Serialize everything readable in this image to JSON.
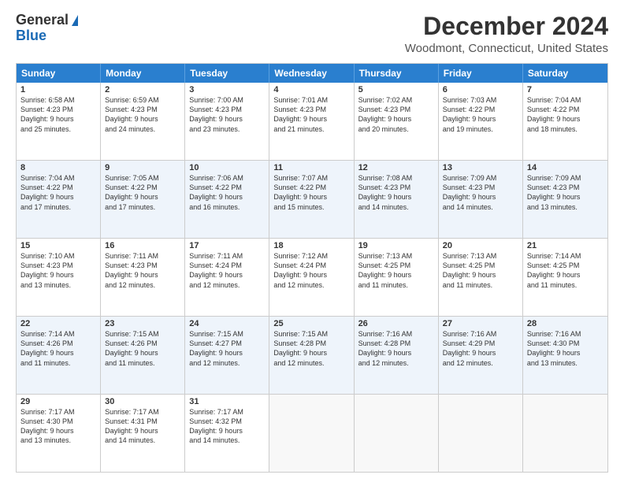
{
  "logo": {
    "general": "General",
    "blue": "Blue"
  },
  "title": "December 2024",
  "subtitle": "Woodmont, Connecticut, United States",
  "days": [
    "Sunday",
    "Monday",
    "Tuesday",
    "Wednesday",
    "Thursday",
    "Friday",
    "Saturday"
  ],
  "weeks": [
    [
      {
        "day": "1",
        "lines": [
          "Sunrise: 6:58 AM",
          "Sunset: 4:23 PM",
          "Daylight: 9 hours",
          "and 25 minutes."
        ]
      },
      {
        "day": "2",
        "lines": [
          "Sunrise: 6:59 AM",
          "Sunset: 4:23 PM",
          "Daylight: 9 hours",
          "and 24 minutes."
        ]
      },
      {
        "day": "3",
        "lines": [
          "Sunrise: 7:00 AM",
          "Sunset: 4:23 PM",
          "Daylight: 9 hours",
          "and 23 minutes."
        ]
      },
      {
        "day": "4",
        "lines": [
          "Sunrise: 7:01 AM",
          "Sunset: 4:23 PM",
          "Daylight: 9 hours",
          "and 21 minutes."
        ]
      },
      {
        "day": "5",
        "lines": [
          "Sunrise: 7:02 AM",
          "Sunset: 4:23 PM",
          "Daylight: 9 hours",
          "and 20 minutes."
        ]
      },
      {
        "day": "6",
        "lines": [
          "Sunrise: 7:03 AM",
          "Sunset: 4:22 PM",
          "Daylight: 9 hours",
          "and 19 minutes."
        ]
      },
      {
        "day": "7",
        "lines": [
          "Sunrise: 7:04 AM",
          "Sunset: 4:22 PM",
          "Daylight: 9 hours",
          "and 18 minutes."
        ]
      }
    ],
    [
      {
        "day": "8",
        "lines": [
          "Sunrise: 7:04 AM",
          "Sunset: 4:22 PM",
          "Daylight: 9 hours",
          "and 17 minutes."
        ]
      },
      {
        "day": "9",
        "lines": [
          "Sunrise: 7:05 AM",
          "Sunset: 4:22 PM",
          "Daylight: 9 hours",
          "and 17 minutes."
        ]
      },
      {
        "day": "10",
        "lines": [
          "Sunrise: 7:06 AM",
          "Sunset: 4:22 PM",
          "Daylight: 9 hours",
          "and 16 minutes."
        ]
      },
      {
        "day": "11",
        "lines": [
          "Sunrise: 7:07 AM",
          "Sunset: 4:22 PM",
          "Daylight: 9 hours",
          "and 15 minutes."
        ]
      },
      {
        "day": "12",
        "lines": [
          "Sunrise: 7:08 AM",
          "Sunset: 4:23 PM",
          "Daylight: 9 hours",
          "and 14 minutes."
        ]
      },
      {
        "day": "13",
        "lines": [
          "Sunrise: 7:09 AM",
          "Sunset: 4:23 PM",
          "Daylight: 9 hours",
          "and 14 minutes."
        ]
      },
      {
        "day": "14",
        "lines": [
          "Sunrise: 7:09 AM",
          "Sunset: 4:23 PM",
          "Daylight: 9 hours",
          "and 13 minutes."
        ]
      }
    ],
    [
      {
        "day": "15",
        "lines": [
          "Sunrise: 7:10 AM",
          "Sunset: 4:23 PM",
          "Daylight: 9 hours",
          "and 13 minutes."
        ]
      },
      {
        "day": "16",
        "lines": [
          "Sunrise: 7:11 AM",
          "Sunset: 4:23 PM",
          "Daylight: 9 hours",
          "and 12 minutes."
        ]
      },
      {
        "day": "17",
        "lines": [
          "Sunrise: 7:11 AM",
          "Sunset: 4:24 PM",
          "Daylight: 9 hours",
          "and 12 minutes."
        ]
      },
      {
        "day": "18",
        "lines": [
          "Sunrise: 7:12 AM",
          "Sunset: 4:24 PM",
          "Daylight: 9 hours",
          "and 12 minutes."
        ]
      },
      {
        "day": "19",
        "lines": [
          "Sunrise: 7:13 AM",
          "Sunset: 4:25 PM",
          "Daylight: 9 hours",
          "and 11 minutes."
        ]
      },
      {
        "day": "20",
        "lines": [
          "Sunrise: 7:13 AM",
          "Sunset: 4:25 PM",
          "Daylight: 9 hours",
          "and 11 minutes."
        ]
      },
      {
        "day": "21",
        "lines": [
          "Sunrise: 7:14 AM",
          "Sunset: 4:25 PM",
          "Daylight: 9 hours",
          "and 11 minutes."
        ]
      }
    ],
    [
      {
        "day": "22",
        "lines": [
          "Sunrise: 7:14 AM",
          "Sunset: 4:26 PM",
          "Daylight: 9 hours",
          "and 11 minutes."
        ]
      },
      {
        "day": "23",
        "lines": [
          "Sunrise: 7:15 AM",
          "Sunset: 4:26 PM",
          "Daylight: 9 hours",
          "and 11 minutes."
        ]
      },
      {
        "day": "24",
        "lines": [
          "Sunrise: 7:15 AM",
          "Sunset: 4:27 PM",
          "Daylight: 9 hours",
          "and 12 minutes."
        ]
      },
      {
        "day": "25",
        "lines": [
          "Sunrise: 7:15 AM",
          "Sunset: 4:28 PM",
          "Daylight: 9 hours",
          "and 12 minutes."
        ]
      },
      {
        "day": "26",
        "lines": [
          "Sunrise: 7:16 AM",
          "Sunset: 4:28 PM",
          "Daylight: 9 hours",
          "and 12 minutes."
        ]
      },
      {
        "day": "27",
        "lines": [
          "Sunrise: 7:16 AM",
          "Sunset: 4:29 PM",
          "Daylight: 9 hours",
          "and 12 minutes."
        ]
      },
      {
        "day": "28",
        "lines": [
          "Sunrise: 7:16 AM",
          "Sunset: 4:30 PM",
          "Daylight: 9 hours",
          "and 13 minutes."
        ]
      }
    ],
    [
      {
        "day": "29",
        "lines": [
          "Sunrise: 7:17 AM",
          "Sunset: 4:30 PM",
          "Daylight: 9 hours",
          "and 13 minutes."
        ]
      },
      {
        "day": "30",
        "lines": [
          "Sunrise: 7:17 AM",
          "Sunset: 4:31 PM",
          "Daylight: 9 hours",
          "and 14 minutes."
        ]
      },
      {
        "day": "31",
        "lines": [
          "Sunrise: 7:17 AM",
          "Sunset: 4:32 PM",
          "Daylight: 9 hours",
          "and 14 minutes."
        ]
      },
      {
        "day": "",
        "lines": []
      },
      {
        "day": "",
        "lines": []
      },
      {
        "day": "",
        "lines": []
      },
      {
        "day": "",
        "lines": []
      }
    ]
  ]
}
